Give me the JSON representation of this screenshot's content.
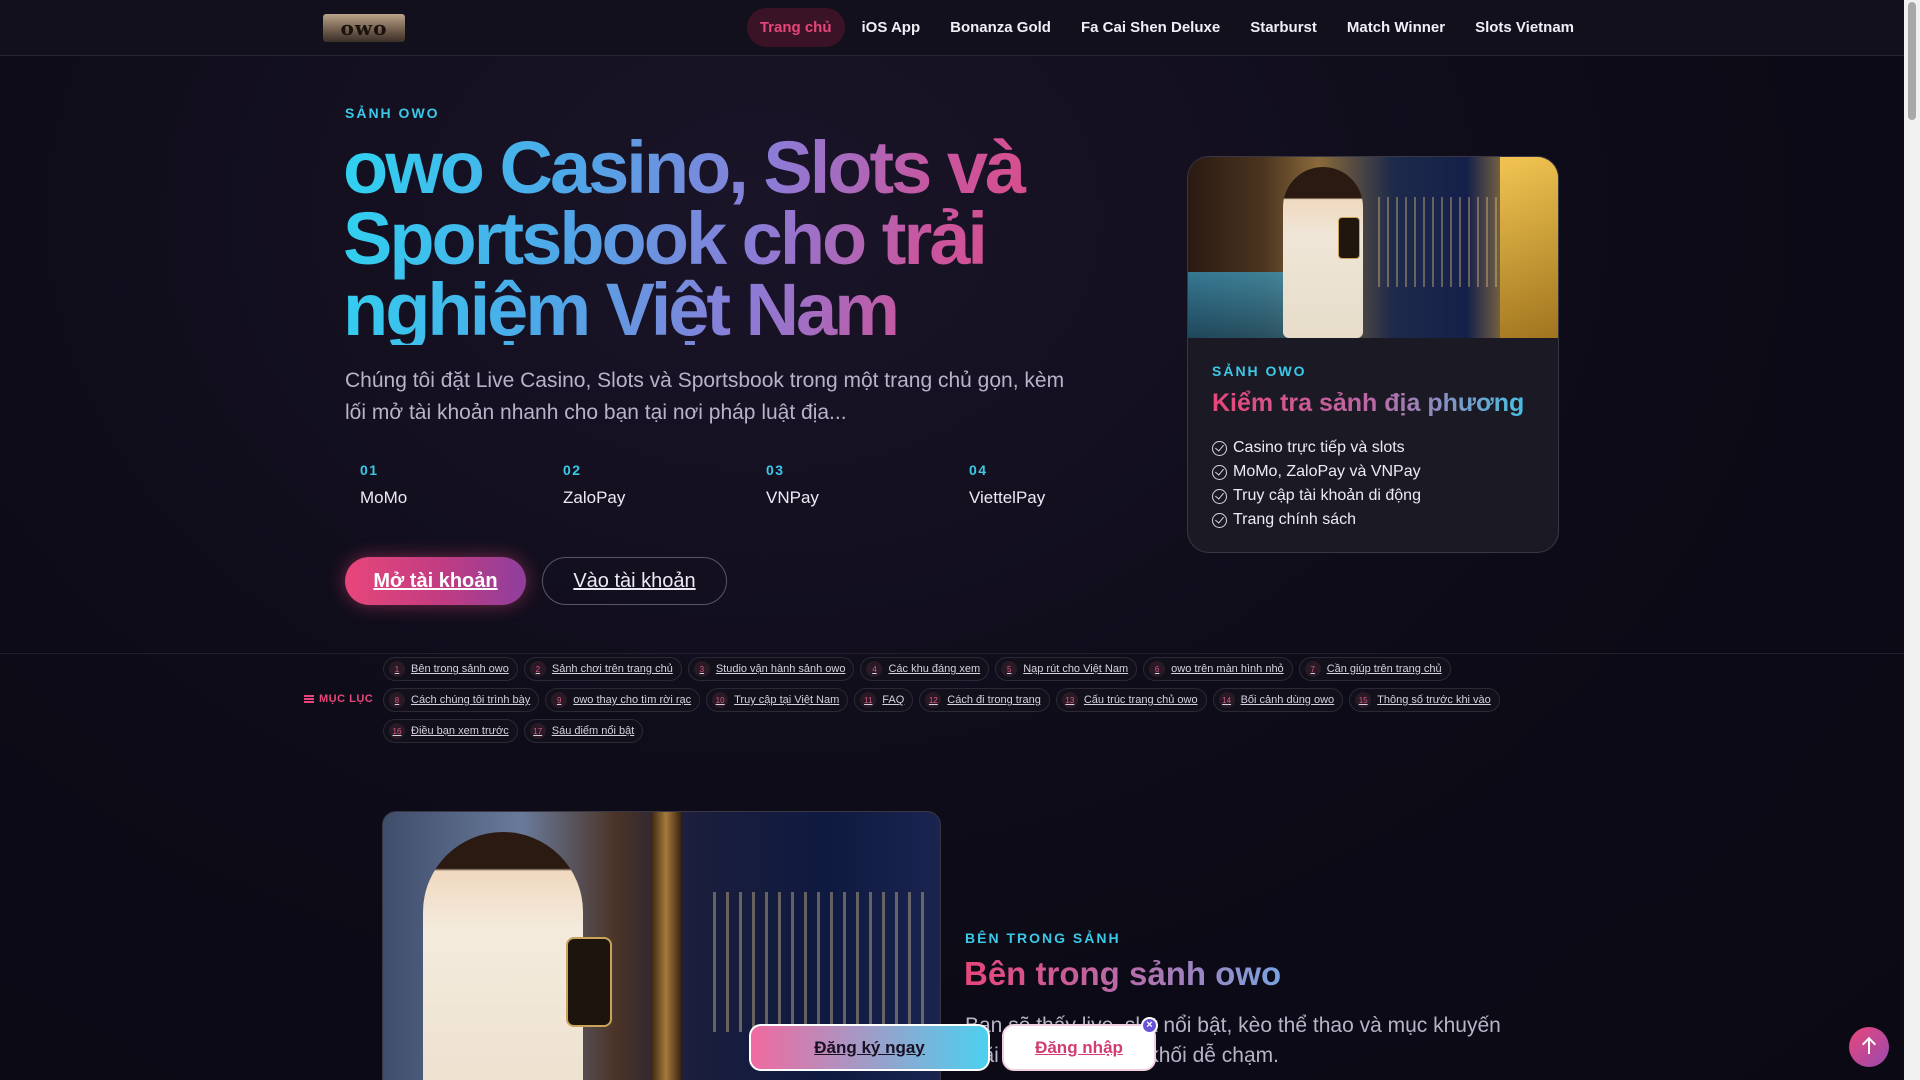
{
  "header": {
    "logo_text": "owo",
    "nav": [
      {
        "label": "Trang chủ",
        "active": true
      },
      {
        "label": "iOS App"
      },
      {
        "label": "Bonanza Gold"
      },
      {
        "label": "Fa Cai Shen Deluxe"
      },
      {
        "label": "Starburst"
      },
      {
        "label": "Match Winner"
      },
      {
        "label": "Slots Vietnam"
      }
    ]
  },
  "hero": {
    "eyebrow": "SẢNH OWO",
    "title": "owo Casino, Slots và Sportsbook cho trải nghiệm Việt Nam",
    "description": "Chúng tôi đặt Live Casino, Slots và Sportsbook trong một trang chủ gọn, kèm lối mở tài khoản nhanh cho bạn tại nơi pháp luật địa...",
    "payments": [
      {
        "num": "01",
        "name": "MoMo"
      },
      {
        "num": "02",
        "name": "ZaloPay"
      },
      {
        "num": "03",
        "name": "VNPay"
      },
      {
        "num": "04",
        "name": "ViettelPay"
      }
    ],
    "primary_button": "Mở tài khoản",
    "secondary_button": "Vào tài khoản"
  },
  "side_card": {
    "eyebrow": "SẢNH OWO",
    "title": "Kiểm tra sảnh địa phương",
    "items": [
      "Casino trực tiếp và slots",
      "MoMo, ZaloPay và VNPay",
      "Truy cập tài khoản di động",
      "Trang chính sách"
    ]
  },
  "toc": {
    "label": "MỤC LỤC",
    "items": [
      {
        "num": "1",
        "label": "Bên trong sảnh owo"
      },
      {
        "num": "2",
        "label": "Sảnh chơi trên trang chủ"
      },
      {
        "num": "3",
        "label": "Studio vận hành sảnh owo"
      },
      {
        "num": "4",
        "label": "Các khu đáng xem"
      },
      {
        "num": "5",
        "label": "Nạp rút cho Việt Nam"
      },
      {
        "num": "6",
        "label": "owo trên màn hình nhỏ"
      },
      {
        "num": "7",
        "label": "Cần giúp trên trang chủ"
      },
      {
        "num": "8",
        "label": "Cách chúng tôi trình bày"
      },
      {
        "num": "9",
        "label": "owo thay cho tìm rời rạc"
      },
      {
        "num": "10",
        "label": "Truy cập tại Việt Nam"
      },
      {
        "num": "11",
        "label": "FAQ"
      },
      {
        "num": "12",
        "label": "Cách đi trong trang"
      },
      {
        "num": "13",
        "label": "Cấu trúc trang chủ owo"
      },
      {
        "num": "14",
        "label": "Bối cảnh dùng owo"
      },
      {
        "num": "15",
        "label": "Thông số trước khi vào"
      },
      {
        "num": "16",
        "label": "Điều bạn xem trước"
      },
      {
        "num": "17",
        "label": "Sáu điểm nổi bật"
      }
    ]
  },
  "section": {
    "eyebrow": "BÊN TRONG SẢNH",
    "title": "Bên trong sảnh owo",
    "description": "Bạn sẽ thấy live, slot nổi bật, kèo thể thao và mục khuyến mãi gom thành các khối dễ chạm."
  },
  "sticky_cta": {
    "register": "Đăng ký ngay",
    "login": "Đăng nhập",
    "close": "×"
  },
  "colors": {
    "accent_pink": "#e8467a",
    "accent_cyan": "#3bc9e8",
    "background": "#0d0b17"
  }
}
